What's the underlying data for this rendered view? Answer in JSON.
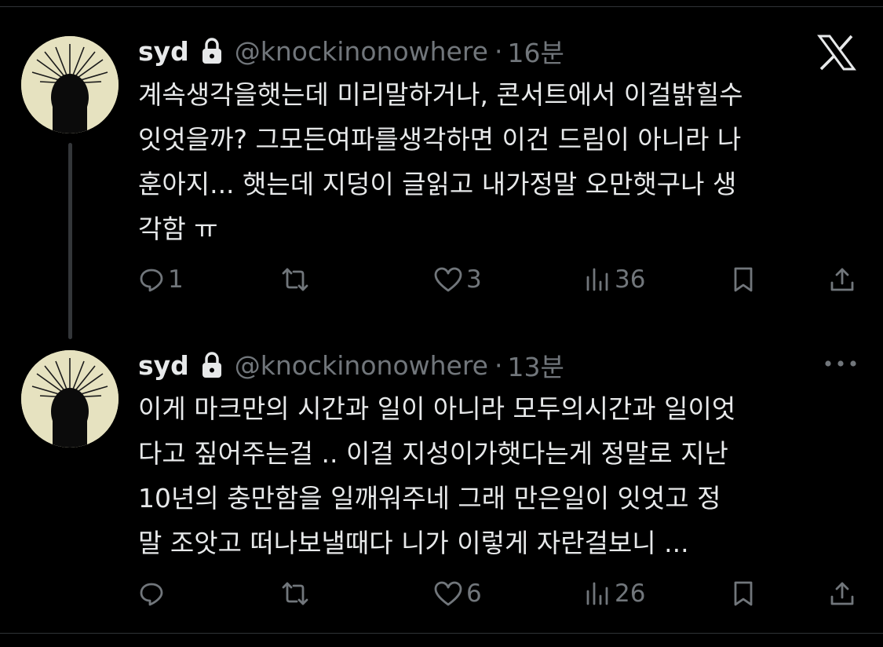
{
  "tweets": [
    {
      "name": "syd",
      "handle": "@knockinonowhere",
      "separator": "·",
      "time": "16분",
      "lines": [
        "계속생각을햇는데 미리말하거나, 콘서트에서 이걸밝힐수",
        "잇엇을까? 그모든여파를생각하면 이건 드림이 아니라 나",
        "훈아지... 햇는데 지덩이 글읽고 내가정말 오만햇구나 생",
        "각함 ㅠ"
      ],
      "replies": "1",
      "retweets": "",
      "likes": "3",
      "views": "36",
      "corner_icon": "x-logo-icon"
    },
    {
      "name": "syd",
      "handle": "@knockinonowhere",
      "separator": "·",
      "time": "13분",
      "lines": [
        "이게 마크만의 시간과 일이 아니라 모두의시간과 일이엇",
        "다고 짚어주는걸 .. 이걸 지성이가햇다는게  정말로 지난",
        "10년의 충만함을 일깨워주네 그래 만은일이 잇엇고 정",
        "말 조앗고 떠나보낼때다 니가 이렇게 자란걸보니 ..."
      ],
      "replies": "",
      "retweets": "",
      "likes": "6",
      "views": "26",
      "corner_icon": "more-icon"
    }
  ],
  "colors": {
    "background": "#000000",
    "text": "#e7e9ea",
    "muted": "#71767b",
    "divider": "#2f3336",
    "thread_line": "#333639",
    "avatar_bg": "#e6e2c0"
  }
}
